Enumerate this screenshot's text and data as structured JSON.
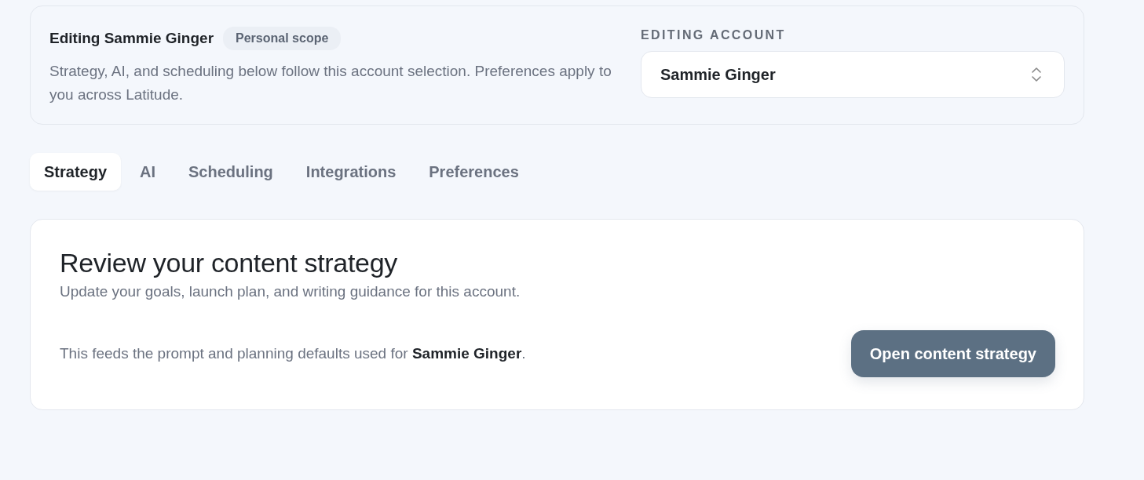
{
  "account_header": {
    "title": "Editing Sammie Ginger",
    "badge": "Personal scope",
    "description": "Strategy, AI, and scheduling below follow this account selection. Preferences apply to you across Latitude.",
    "selector_label": "EDITING ACCOUNT",
    "selector_value": "Sammie Ginger"
  },
  "tabs": [
    {
      "label": "Strategy",
      "selected": true
    },
    {
      "label": "AI",
      "selected": false
    },
    {
      "label": "Scheduling",
      "selected": false
    },
    {
      "label": "Integrations",
      "selected": false
    },
    {
      "label": "Preferences",
      "selected": false
    }
  ],
  "panel": {
    "title": "Review your content strategy",
    "subtitle": "Update your goals, launch plan, and writing guidance for this account.",
    "note": "This feeds the prompt and planning defaults used for **Sammie Ginger**.",
    "button": "Open content strategy"
  }
}
